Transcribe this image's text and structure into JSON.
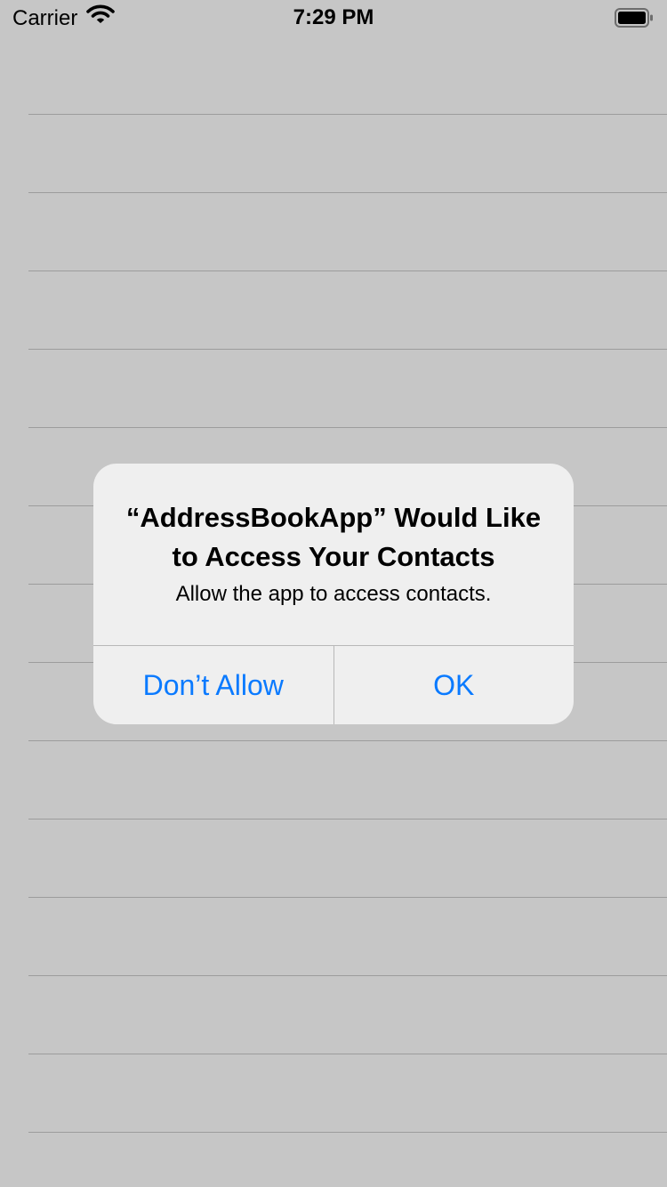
{
  "status_bar": {
    "carrier": "Carrier",
    "time": "7:29 PM",
    "wifi_icon": "wifi-icon",
    "battery_icon": "battery-full-icon"
  },
  "table": {
    "row_count": 14
  },
  "alert": {
    "title": "“AddressBookApp” Would Like to Access Your Contacts",
    "message": "Allow the app to access contacts.",
    "buttons": [
      {
        "label": "Don’t Allow"
      },
      {
        "label": "OK"
      }
    ],
    "button_color": "#0a7aff"
  },
  "colors": {
    "background": "#c6c6c6",
    "separator": "#9c9c9c",
    "alert_background": "#efefef"
  }
}
